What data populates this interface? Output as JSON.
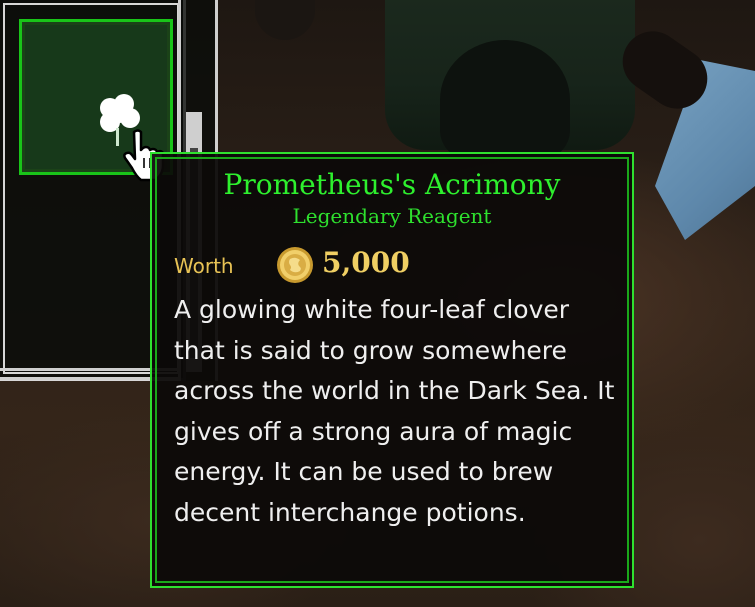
{
  "item_tooltip": {
    "name": "Prometheus's Acrimony",
    "rarity_type": "Legendary Reagent",
    "worth_label": "Worth",
    "worth_value": "5,000",
    "description": "A glowing white four-leaf clover that is said to grow somewhere across the world in the Dark Sea. It gives off a strong aura of magic energy. It can be used to brew decent interchange potions.",
    "colors": {
      "border": "#2fe02f",
      "title": "#2ef02e",
      "worth": "#e8c355"
    }
  },
  "inventory": {
    "selected_slot_icon": "clover-icon",
    "cursor_icon": "hand-pointer-icon",
    "slot_color": "#1b4218",
    "slot_border_color": "#19c419"
  }
}
